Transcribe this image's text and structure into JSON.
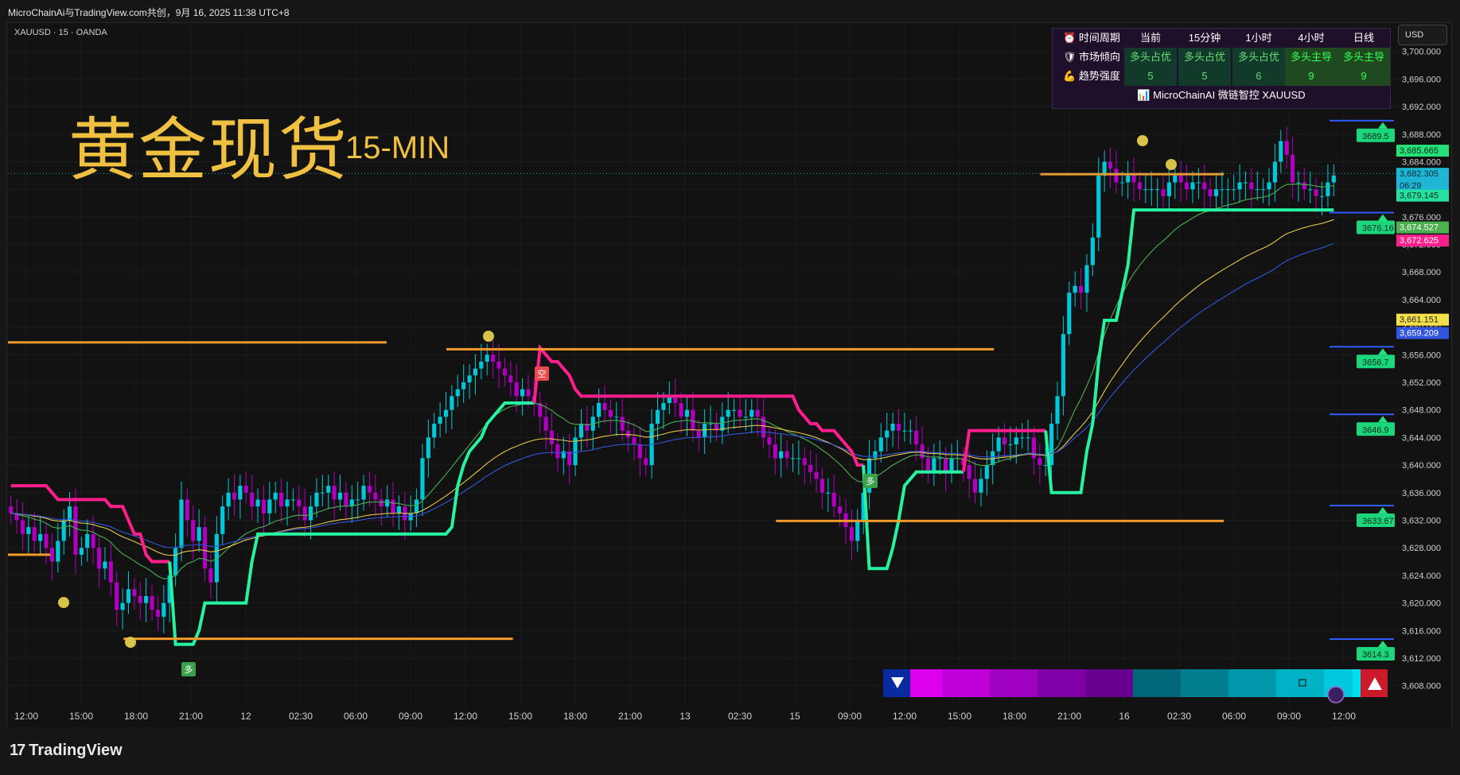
{
  "topbar": {
    "text": "MicroChainAi与TradingView.com共创，9月 16, 2025 11:38 UTC+8"
  },
  "symbol": {
    "text": "XAUUSD · 15 · OANDA"
  },
  "title": {
    "main": "黄金现货",
    "sub": "15-MIN"
  },
  "currency": "USD",
  "info_table": {
    "header": [
      "⏰ 时间周期",
      "当前",
      "15分钟",
      "1小时",
      "4小时",
      "日线"
    ],
    "rows": [
      {
        "label": "🛡 市场倾向",
        "values": [
          "多头占优",
          "多头占优",
          "多头占优",
          "多头主导",
          "多头主导"
        ]
      },
      {
        "label": "💪 趋势强度",
        "values": [
          "5",
          "5",
          "6",
          "9",
          "9"
        ]
      }
    ],
    "footer": "📊 MicroChainAI 微链智控  XAUUSD"
  },
  "markers": {
    "long": "多",
    "short": "空"
  },
  "footer": {
    "logo": "TradingView",
    "logo_mark": "17"
  },
  "colors": {
    "background": "#121212",
    "up": "#00c8d8",
    "down": "#b000c0",
    "trail_up": "#26f2a0",
    "trail_down": "#ff1e8c",
    "level": "#f39a2a",
    "ema_fast": "#4caf50",
    "ema_mid": "#e6c84a",
    "ema_slow": "#3355dd",
    "title": "#f0c040"
  },
  "chart_data": {
    "type": "candlestick",
    "symbol": "XAUUSD",
    "interval": "15",
    "ylim": [
      3606,
      3704
    ],
    "y_ticks": [
      "3,700.000",
      "3,696.000",
      "3,692.000",
      "3,688.000",
      "3,684.000",
      "3,680.000",
      "3,676.000",
      "3,672.000",
      "3,668.000",
      "3,664.000",
      "3,660.000",
      "3,656.000",
      "3,652.000",
      "3,648.000",
      "3,644.000",
      "3,640.000",
      "3,636.000",
      "3,632.000",
      "3,628.000",
      "3,624.000",
      "3,620.000",
      "3,616.000",
      "3,612.000",
      "3,608.000"
    ],
    "x_ticks": [
      "12:00",
      "15:00",
      "18:00",
      "21:00",
      "12",
      "02:30",
      "06:00",
      "09:00",
      "12:00",
      "15:00",
      "18:00",
      "21:00",
      "13",
      "02:30",
      "15",
      "09:00",
      "12:00",
      "15:00",
      "18:00",
      "21:00",
      "16",
      "02:30",
      "06:00",
      "09:00",
      "12:00"
    ],
    "price_labels": [
      {
        "text": "3,685.665",
        "value": 3685.665,
        "color": "#26e07a",
        "text_color": "#0b2a18"
      },
      {
        "text": "3,682.305",
        "value": 3682.305,
        "color": "#1fb6d6",
        "text_color": "#062a33"
      },
      {
        "text": "06:29",
        "value": 3680.6,
        "color": "#1fb6d6",
        "text_color": "#062a33"
      },
      {
        "text": "3,679.145",
        "value": 3679.145,
        "color": "#26e0a0",
        "text_color": "#062a1e"
      },
      {
        "text": "3,674.527",
        "value": 3674.527,
        "color": "#4caf50",
        "text_color": "#ffffff"
      },
      {
        "text": "3,672.625",
        "value": 3672.625,
        "color": "#ff1e8c",
        "text_color": "#ffffff"
      },
      {
        "text": "3,661.151",
        "value": 3661.151,
        "color": "#f5e04a",
        "text_color": "#222222"
      },
      {
        "text": "3,659.209",
        "value": 3659.209,
        "color": "#3355dd",
        "text_color": "#ffffff"
      }
    ],
    "level_labels": [
      {
        "text": "3689.5",
        "value": 3689.5
      },
      {
        "text": "3676.16",
        "value": 3676.16
      },
      {
        "text": "3656.7",
        "value": 3656.7
      },
      {
        "text": "3646.9",
        "value": 3646.9
      },
      {
        "text": "3633.67",
        "value": 3633.67
      },
      {
        "text": "3614.3",
        "value": 3614.3
      }
    ],
    "resistance_levels": [
      {
        "value": 3657.8,
        "x_start": 0.0,
        "x_end": 0.285
      },
      {
        "value": 3656.8,
        "x_start": 0.33,
        "x_end": 0.742
      },
      {
        "value": 3682.2,
        "x_start": 0.777,
        "x_end": 0.915
      },
      {
        "value": 3631.9,
        "x_start": 0.578,
        "x_end": 0.915
      },
      {
        "value": 3614.8,
        "x_start": 0.087,
        "x_end": 0.38
      },
      {
        "value": 3627.0,
        "x_start": 0.0,
        "x_end": 0.032
      }
    ],
    "close": [
      3633,
      3632,
      3630,
      3631,
      3629,
      3630,
      3628,
      3626,
      3629,
      3632,
      3634,
      3627,
      3628,
      3630,
      3628,
      3625,
      3626,
      3623,
      3619,
      3620,
      3622,
      3621,
      3620,
      3621,
      3619,
      3618,
      3620,
      3624,
      3628,
      3635,
      3632,
      3629,
      3631,
      3625,
      3623,
      3630,
      3634,
      3636,
      3635,
      3637,
      3636,
      3634,
      3635,
      3633,
      3635,
      3636,
      3634,
      3635,
      3635,
      3634,
      3632,
      3634,
      3636,
      3636,
      3637,
      3635,
      3636,
      3634,
      3635,
      3635,
      3637,
      3636,
      3635,
      3634,
      3635,
      3633,
      3634,
      3632,
      3633,
      3635,
      3641,
      3644,
      3646,
      3647,
      3648,
      3650,
      3651,
      3652,
      3653,
      3654,
      3655,
      3656,
      3655,
      3654,
      3653,
      3652,
      3650,
      3651,
      3650,
      3649,
      3647,
      3645,
      3643,
      3641,
      3642,
      3640,
      3644,
      3646,
      3645,
      3647,
      3649,
      3648,
      3647,
      3647,
      3645,
      3644,
      3643,
      3641,
      3640,
      3646,
      3648,
      3649,
      3650,
      3649,
      3647,
      3648,
      3645,
      3644,
      3646,
      3646,
      3645,
      3647,
      3648,
      3648,
      3647,
      3647,
      3648,
      3647,
      3644,
      3643,
      3641,
      3642,
      3641,
      3641,
      3641,
      3640,
      3639,
      3638,
      3636,
      3636,
      3634,
      3633,
      3631,
      3629,
      3632,
      3636,
      3641,
      3642,
      3644,
      3645,
      3646,
      3645,
      3645,
      3645,
      3643,
      3641,
      3639,
      3641,
      3641,
      3639,
      3641,
      3641,
      3640,
      3638,
      3636,
      3638,
      3640,
      3642,
      3644,
      3643,
      3643,
      3644,
      3644,
      3644,
      3641,
      3640,
      3640,
      3646,
      3650,
      3659,
      3665,
      3666,
      3665,
      3669,
      3673,
      3682,
      3684,
      3683,
      3681,
      3681,
      3682,
      3681,
      3680,
      3680,
      3680,
      3680,
      3679,
      3681,
      3682,
      3681,
      3680,
      3681,
      3681,
      3680,
      3679,
      3680,
      3680,
      3680,
      3680,
      3681,
      3681,
      3680,
      3680,
      3680,
      3681,
      3684,
      3687,
      3685,
      3681,
      3681,
      3680,
      3680,
      3679,
      3679,
      3681,
      3682
    ]
  }
}
